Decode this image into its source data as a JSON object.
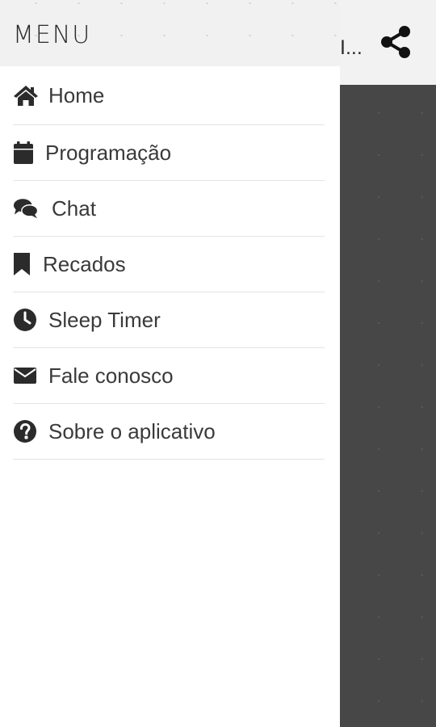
{
  "app": {
    "title": "I..."
  },
  "drawer": {
    "title": "MENU",
    "items": [
      {
        "label": "Home",
        "icon": "home-icon"
      },
      {
        "label": "Programação",
        "icon": "calendar-icon"
      },
      {
        "label": "Chat",
        "icon": "chat-icon"
      },
      {
        "label": "Recados",
        "icon": "bookmark-icon"
      },
      {
        "label": "Sleep Timer",
        "icon": "clock-icon"
      },
      {
        "label": "Fale conosco",
        "icon": "envelope-icon"
      },
      {
        "label": "Sobre o aplicativo",
        "icon": "question-circle-icon"
      }
    ]
  },
  "colors": {
    "drawer_bg": "#ffffff",
    "header_bg": "#f1f1f1",
    "overlay": "#474747",
    "text": "#3a3a3a",
    "icon": "#2b2b2b"
  }
}
